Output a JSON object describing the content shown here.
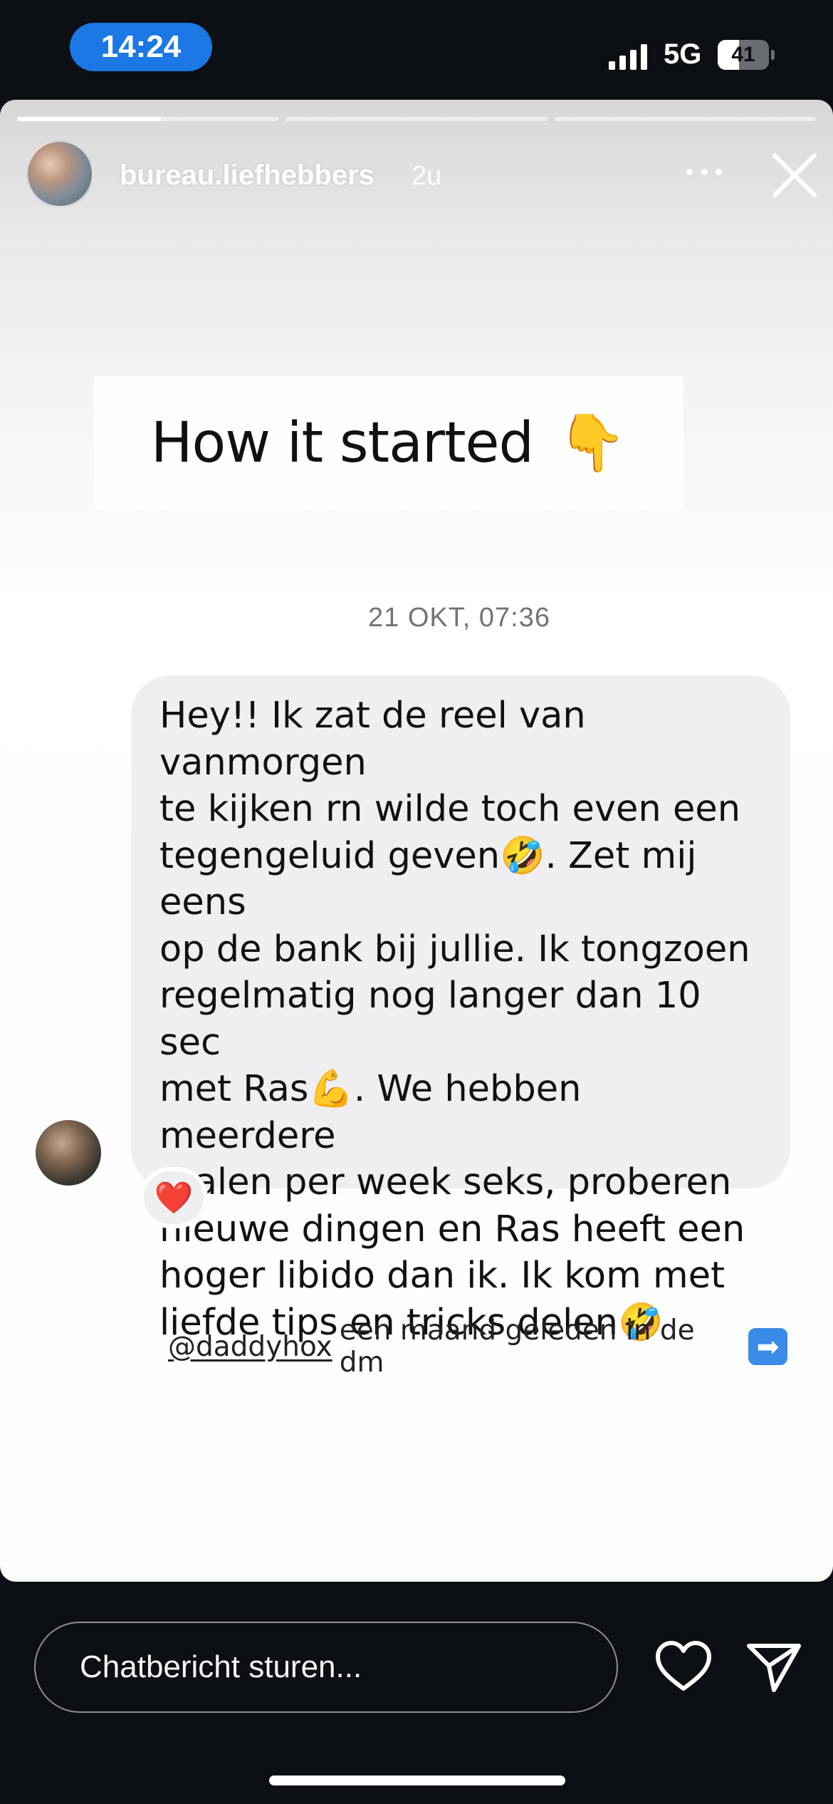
{
  "status_bar": {
    "time": "14:24",
    "network": "5G",
    "battery": "41",
    "battery_level": 0.41,
    "signal_bars": 4
  },
  "story": {
    "progress": {
      "segments": 3,
      "current_segment_fill": 0.55
    },
    "header": {
      "username": "bureau.liefhebbers",
      "time_ago": "2u",
      "more_icon": "more-horizontal-icon",
      "close_icon": "close-icon"
    },
    "title_card": {
      "text": "How it started",
      "emoji": "👇"
    },
    "dm": {
      "timestamp": "21 OKT, 07:36",
      "message": "Hey!! Ik zat de reel van vanmorgen\nte kijken rn wilde toch even een\ntegengeluid geven🤣. Zet mij eens\nop de bank bij jullie. Ik tongzoen\nregelmatig nog langer dan 10 sec\nmet Ras💪. We hebben meerdere\nmalen per week seks, proberen\nnieuwe dingen en Ras heeft een\nhoger libido dan ik. Ik kom met\nliefde tips en tricks delen🤣",
      "reaction": "❤️"
    },
    "caption": {
      "mention": "@daddyhox",
      "text": "een maand geleden in de dm",
      "arrow": "➡"
    }
  },
  "reply_bar": {
    "placeholder": "Chatbericht sturen...",
    "like_icon": "heart-icon",
    "send_icon": "send-icon"
  },
  "colors": {
    "app_background": "#0c1014",
    "time_pill": "#1b78e4",
    "bubble": "#efeff1",
    "arrow_box": "#3b8be8"
  }
}
